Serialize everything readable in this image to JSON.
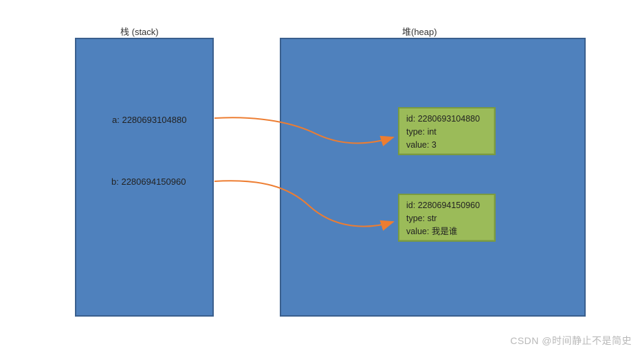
{
  "labels": {
    "stack": "栈 (stack)",
    "heap": "堆(heap)"
  },
  "stack": {
    "vars": [
      {
        "name": "a",
        "id": "2280693104880"
      },
      {
        "name": "b",
        "id": "2280694150960"
      }
    ]
  },
  "heap": {
    "objects": [
      {
        "id": "2280693104880",
        "type": "int",
        "value": "3"
      },
      {
        "id": "2280694150960",
        "type": "str",
        "value": "我是谁"
      }
    ]
  },
  "watermark": "CSDN @时间静止不是简史",
  "colors": {
    "box_fill": "#4f81bd",
    "box_border": "#3a5f8d",
    "obj_fill": "#9bbb59",
    "obj_border": "#7a9a3f",
    "arrow": "#ed7d31"
  },
  "chart_data": {
    "type": "diagram",
    "description": "Python variable name/id on stack points to object (id, type, value) on heap",
    "references": [
      {
        "var": "a",
        "ref_id": "2280693104880",
        "obj_type": "int",
        "obj_value": "3"
      },
      {
        "var": "b",
        "ref_id": "2280694150960",
        "obj_type": "str",
        "obj_value": "我是谁"
      }
    ]
  }
}
